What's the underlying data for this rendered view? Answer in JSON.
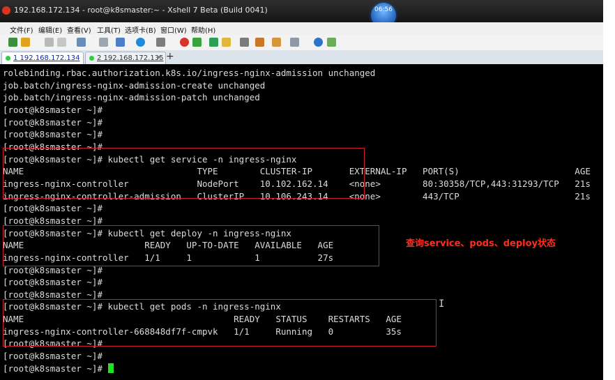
{
  "window": {
    "title": "192.168.172.134 - root@k8smaster:~ - Xshell 7 Beta (Build 0041)",
    "clock": "06:56"
  },
  "menu": [
    {
      "label": "文件(F)"
    },
    {
      "label": "编辑(E)"
    },
    {
      "label": "查看(V)"
    },
    {
      "label": "工具(T)"
    },
    {
      "label": "选项卡(B)"
    },
    {
      "label": "窗口(W)"
    },
    {
      "label": "帮助(H)"
    }
  ],
  "tabs": [
    {
      "label": "1 192.168.172.134",
      "status_color": "#2ecc40",
      "active": true
    },
    {
      "label": "2 192.168.172.135",
      "status_color": "#2ecc40",
      "active": false
    }
  ],
  "tab_close_glyph": "×",
  "tab_add_glyph": "+",
  "terminal": {
    "lines": [
      "rolebinding.rbac.authorization.k8s.io/ingress-nginx-admission unchanged",
      "job.batch/ingress-nginx-admission-create unchanged",
      "job.batch/ingress-nginx-admission-patch unchanged",
      "[root@k8smaster ~]#",
      "[root@k8smaster ~]#",
      "[root@k8smaster ~]#",
      "[root@k8smaster ~]#",
      "[root@k8smaster ~]# kubectl get service -n ingress-nginx",
      "NAME                                 TYPE        CLUSTER-IP       EXTERNAL-IP   PORT(S)                      AGE",
      "ingress-nginx-controller             NodePort    10.102.162.14    <none>        80:30358/TCP,443:31293/TCP   21s",
      "ingress-nginx-controller-admission   ClusterIP   10.106.243.14    <none>        443/TCP                      21s",
      "[root@k8smaster ~]#",
      "[root@k8smaster ~]#",
      "[root@k8smaster ~]# kubectl get deploy -n ingress-nginx",
      "NAME                       READY   UP-TO-DATE   AVAILABLE   AGE",
      "ingress-nginx-controller   1/1     1            1           27s",
      "[root@k8smaster ~]#",
      "[root@k8smaster ~]#",
      "[root@k8smaster ~]#",
      "[root@k8smaster ~]# kubectl get pods -n ingress-nginx",
      "NAME                                        READY   STATUS    RESTARTS   AGE",
      "ingress-nginx-controller-668848df7f-cmpvk   1/1     Running   0          35s",
      "[root@k8smaster ~]#",
      "[root@k8smaster ~]#",
      "[root@k8smaster ~]#"
    ],
    "annotation": "查询service、pods、deploy状态",
    "annotation_color": "#ff2d20",
    "highlight_color": "#d01c2a",
    "cursor_color": "#23e023"
  },
  "toolbar_icons": [
    "new-session-icon",
    "open-folder-icon",
    "disconnect-icon",
    "reconnect-icon",
    "transfer-icon",
    "find-icon",
    "properties-icon",
    "globe-icon",
    "font-icon",
    "xftp-icon",
    "xftp-green-icon",
    "fullscreen-icon",
    "lock-icon",
    "keyboard-icon",
    "highlight-icon",
    "script-icon",
    "layout-icon",
    "help-icon",
    "chat-icon"
  ]
}
